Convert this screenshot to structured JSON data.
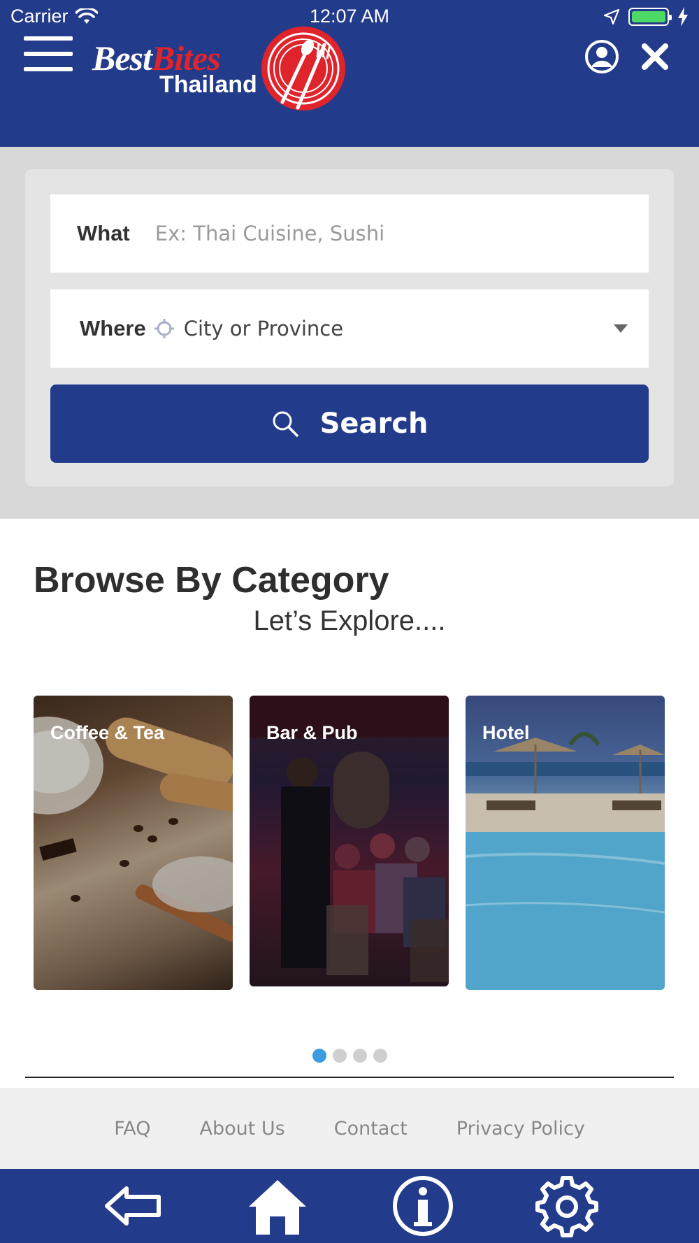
{
  "status_bar": {
    "carrier": "Carrier",
    "time": "12:07 AM"
  },
  "header": {
    "logo": {
      "best": "Best",
      "bites": "Bites",
      "thailand": "Thailand"
    },
    "icons": [
      "menu-icon",
      "user-icon",
      "close-icon"
    ],
    "colors": {
      "primary": "#233b8b",
      "logo_red": "#e0242c"
    }
  },
  "search": {
    "what_label": "What",
    "what_placeholder": "Ex: Thai Cuisine, Sushi",
    "what_value": "",
    "where_label": "Where",
    "where_value": "City or Province",
    "button_label": "Search"
  },
  "category": {
    "title": "Browse By Category",
    "subtitle": "Let’s Explore....",
    "cards": [
      {
        "label": "Coffee & Tea"
      },
      {
        "label": "Bar & Pub"
      },
      {
        "label": "Hotel"
      }
    ],
    "pager": {
      "count": 4,
      "active": 0,
      "active_color": "#3d9be0"
    }
  },
  "footer": {
    "links": [
      "FAQ",
      "About Us",
      "Contact",
      "Privacy Policy"
    ]
  },
  "bottom_nav": {
    "items": [
      "back-arrow-icon",
      "home-icon",
      "info-icon",
      "gear-icon"
    ]
  }
}
